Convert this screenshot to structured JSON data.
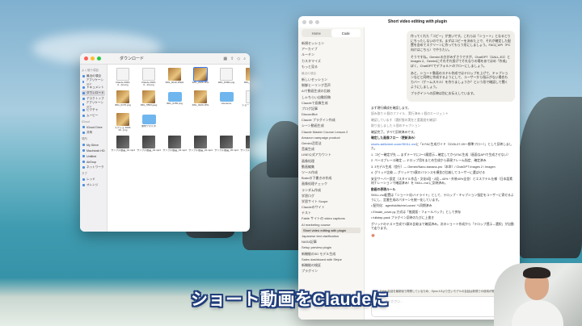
{
  "finder": {
    "title": "ダウンロード",
    "sidebar": [
      {
        "head": "よく使う項目"
      },
      {
        "label": "最近の項目"
      },
      {
        "label": "アプリケーション"
      },
      {
        "label": "ドキュメント"
      },
      {
        "label": "ダウンロード",
        "active": true
      },
      {
        "label": "デスクトップ"
      },
      {
        "label": "アプリケーション"
      },
      {
        "label": "ピクチャ"
      },
      {
        "label": "ムービー"
      },
      {
        "head": "iCloud"
      },
      {
        "label": "iCloud Drive"
      },
      {
        "label": "共有"
      },
      {
        "head": "場所"
      },
      {
        "label": "My iDrive"
      },
      {
        "label": "Macintosh HD"
      },
      {
        "label": "Untitled"
      },
      {
        "label": "AirDrop"
      },
      {
        "label": "ネットワーク"
      },
      {
        "head": "タグ"
      },
      {
        "label": "レッド"
      },
      {
        "label": "オレンジ"
      }
    ],
    "files": [
      {
        "name": "Claude 2026-0...12.png",
        "kind": "doc"
      },
      {
        "name": "Claude 2026-0...13.png",
        "kind": "doc"
      },
      {
        "name": "IMG_0010.JPEG",
        "kind": "food"
      },
      {
        "name": "IMG_2468.JPG",
        "kind": "food",
        "selected": true
      },
      {
        "name": "IMG_D382.png",
        "kind": "doc"
      },
      {
        "name": "IMG_8177.jpeg",
        "kind": "food"
      },
      {
        "name": "IMG_0176.png",
        "kind": "food"
      },
      {
        "name": "IMG_5553.jpeg",
        "kind": "food"
      },
      {
        "name": "IMG_0155.png",
        "kind": "folder"
      },
      {
        "name": "IMG_0220.JPG",
        "kind": "food"
      },
      {
        "name": "reference",
        "kind": "folder"
      },
      {
        "name": "ショート動画_制作",
        "kind": "doc"
      },
      {
        "name": "スクショ 2026-02...png",
        "kind": "food"
      },
      {
        "name": "素材フォルダ",
        "kind": "folder"
      },
      {
        "name": "",
        "kind": "empty"
      },
      {
        "name": "",
        "kind": "empty"
      },
      {
        "name": "",
        "kind": "empty"
      },
      {
        "name": "",
        "kind": "empty"
      },
      {
        "name": "サンプル動画_01.mp4",
        "kind": "dark"
      },
      {
        "name": "サンプル動画_02.mp4",
        "kind": "dark"
      },
      {
        "name": "サンプル動画_03.mp4",
        "kind": "dark"
      },
      {
        "name": "サンプル動画_04.mp4",
        "kind": "dark"
      },
      {
        "name": "サンプル動画_05.mp4",
        "kind": "dark"
      },
      {
        "name": "サンプル動画_06.mp4",
        "kind": "dark"
      }
    ]
  },
  "claude": {
    "title": "Short video editing with plugin",
    "tabs": [
      "Home",
      "Code"
    ],
    "active_tab": "Code",
    "sidebar": [
      {
        "label": "新規セッション"
      },
      {
        "label": "アーカイブ"
      },
      {
        "label": "ルーチン"
      },
      {
        "label": "カスタマイズ"
      },
      {
        "label": "もっと見る"
      },
      {
        "head": "最近の項目"
      },
      {
        "label": "新しいセッション"
      },
      {
        "label": "制御ヒーリング音声"
      },
      {
        "label": "AIで動画生成の比較"
      },
      {
        "label": "しゃちらい自動投稿"
      },
      {
        "label": "Claudeで画像生成"
      },
      {
        "label": "ブログ記事"
      },
      {
        "label": "DiscordBot"
      },
      {
        "label": "Claude プラグイン作成"
      },
      {
        "label": "シーン動画生成"
      },
      {
        "label": "Claude Master Course Lesson 2"
      },
      {
        "label": "Amazon campaign product"
      },
      {
        "label": "Gemini活用法"
      },
      {
        "label": "音楽生成"
      },
      {
        "label": "LINE公式アカウント"
      },
      {
        "label": "画像処理"
      },
      {
        "label": "動画編集"
      },
      {
        "label": "ツール作成"
      },
      {
        "label": "Brainの下書きの作成"
      },
      {
        "label": "画像処理チェック"
      },
      {
        "label": "ランダム作成"
      },
      {
        "label": "学習ログ"
      },
      {
        "label": "学習サイト Scope"
      },
      {
        "label": "Claudeのサイト"
      },
      {
        "label": "テスト"
      },
      {
        "label": "Fable サイトの video captions"
      },
      {
        "label": "AI marketing course"
      },
      {
        "label": "Short video editing with plugin",
        "highlight": true
      },
      {
        "label": "Japanese text clarification"
      },
      {
        "label": "NASA記事"
      },
      {
        "label": "Setup preview plugin"
      },
      {
        "label": "新機能の3D モデル生成"
      },
      {
        "label": "Sales dashboard with Stripe"
      },
      {
        "label": "新機能の検証"
      },
      {
        "label": "プラグイン"
      }
    ],
    "user_message": [
      "作ってくれた「コピー」が良いです。これらは「ショート」となるとりにちったしないのです。まずはコピーを決めた上で、それが確定した配置を含めてスクリーンに作ってもらう形にしましょう。FACにAPI（PC 向けはこちら）でやりたい。",
      "そうですね。Gemini の方がみずさうですが、ChatGPT（DALL-E3）と Images 2、Geminiにそれぞれ投げてそれなりの場をあてはめ「作成」ぽく、ChatGPTでデフォルトのフローにしましょう。",
      "あと、ショート動画のスキル作成ではテロップを上げて、キャプションなどと同時に作成するようにして、ユーザーから指示がない場合もカバー（ゲームスキル）を作りましょうか？という形で確認して聞くようにしましょう。",
      "プラグインへの反映は別にお伝えしています。"
    ],
    "assistant": {
      "intro": "まず現行構成を確認します。",
      "tool1": "読み取り 5 個のファイル、実行済み 1 個のエージェント",
      "tool2": "確認しています（選択肢の実在と重要度を確認）",
      "tool3": "取り出しました 5 個のキャプション",
      "done": "確認完了。すべて反映済みです。",
      "section": "確定した画像フロー（更新済み）",
      "link": "shorts-skills/reel-cover/SKILL.md",
      "link_tail": "に「6 FAC生成ガイド（2026-07-09〜標準フロー）」として反映しました。",
      "steps": [
        "1. コピー確定が先 — まずテーマに2〜3案提示→確定してからFAC生成（画面なAPIで生成させない）",
        "2. ベースプレース確定 — テロップ用をまとめ生成から表現フレーム指定、確定済み",
        "3. 3モデル生成（並行）— Gemini/Nano-banana-pro（本命）/ ChatGPT Images 2 / Imagen",
        "4. グリッド比較 — グリッドで3案のバランスを横並び比較してユーザーに選ばせる"
      ],
      "note": "安全サーバー設定（スタイル作品・文化5段・2段→40%・外装40%全並）とエスクテル仕様（日本語素材ナレーションで確認済み）を SKILL.md に反映済み。",
      "heading2": "動画の表現ルール",
      "body2": "SKILL.md配置は「ショート化/ハイライト」として、テロップ・キャプション指定をユーザーに寄せるようにし、定番生成のパターンを統一化しています。",
      "bullets": [
        "配列化：agent/skills/reel-cover/ へ同期済み",
        "Elmate_cover.py 方式は「推奨版・フォールバック」として併存",
        "fullstep-pack プラグイン反映のたびに上書き"
      ],
      "closing": "グリッドのテスト生成で3案の比較まで確認済み。次のショート作成から「テロップ提示→選択」が自動で走ります。"
    },
    "notice": "Fable 会話を最新版で再開しているため、Opus 4.8より古いモデルの会話は新規での使用が推奨されます。",
    "composer_placeholder": "返信してください…"
  },
  "caption": "ショート動画をClaudeに"
}
